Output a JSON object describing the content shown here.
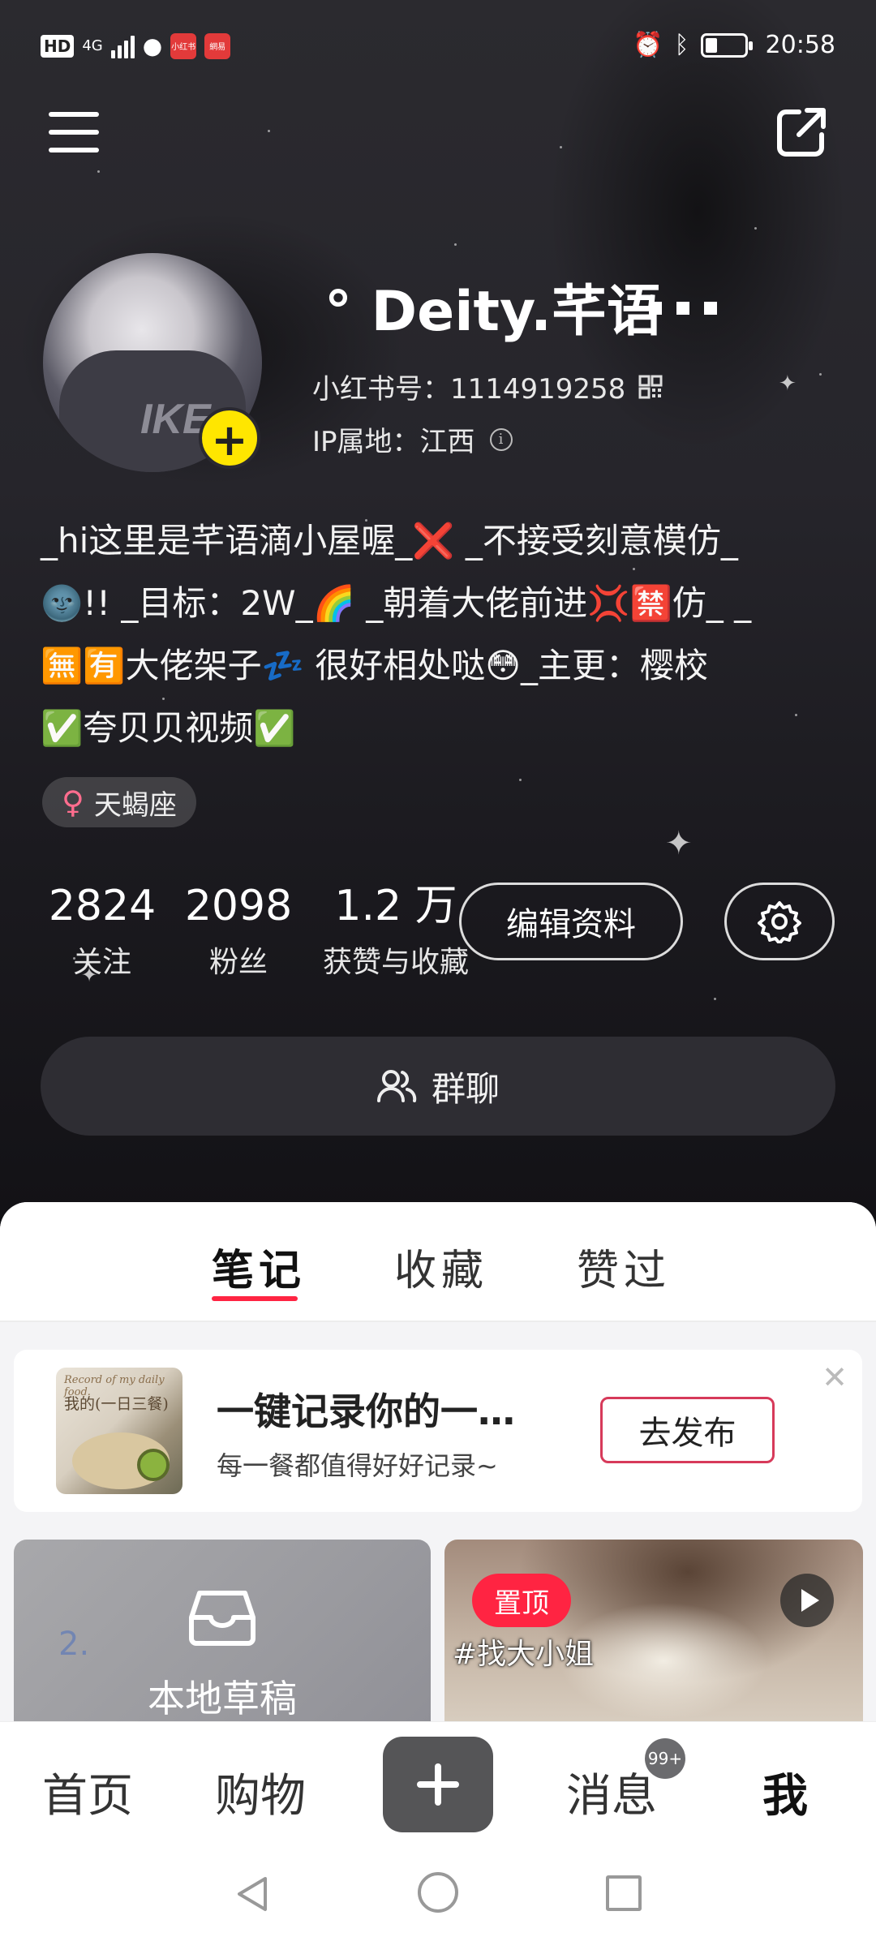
{
  "status_bar": {
    "hd": "HD",
    "network": "4G",
    "app1": "小红书",
    "app2": "網易",
    "time": "20:58"
  },
  "profile": {
    "nickname": "° Deity.芊语",
    "red_id": "小红书号：1114919258",
    "ip_location": "IP属地：江西",
    "bio": "_hi这里是芊语滴小屋喔_❌ _不接受刻意模仿_\n🌚!! _目标：2W_🌈 _朝着大佬前进💢🈲仿_ _\n🈚🈶大佬架子💤 很好相处哒😳_主更：樱校\n✅夸贝贝视频✅",
    "zodiac": "天蝎座",
    "stats": [
      {
        "value": "2824",
        "label": "关注"
      },
      {
        "value": "2098",
        "label": "粉丝"
      },
      {
        "value": "1.2 万",
        "label": "获赞与收藏"
      }
    ],
    "edit_button": "编辑资料",
    "group_chat": "群聊"
  },
  "tabs": [
    "笔记",
    "收藏",
    "赞过"
  ],
  "active_tab": "笔记",
  "promo": {
    "thumb_line1": "Record of my daily food.",
    "thumb_line2": "我的(一日三餐)",
    "title": "一键记录你的一…",
    "subtitle": "每一餐都值得好好记录~",
    "button": "去发布"
  },
  "cards": {
    "draft_label": "本地草稿",
    "draft_bg_number": "2.",
    "pinned_badge": "置顶",
    "video_tag": "#找大小姐"
  },
  "bottom_nav": {
    "home": "首页",
    "shop": "购物",
    "messages": "消息",
    "messages_badge": "99+",
    "me": "我"
  },
  "icons": {
    "menu": "menu-icon",
    "share": "share-icon",
    "qr": "qr-code-icon",
    "info": "info-icon",
    "settings": "gear-icon",
    "group": "people-icon",
    "close": "close-icon",
    "draft": "inbox-icon",
    "play": "play-icon",
    "add": "plus-icon"
  },
  "colors": {
    "accent": "#ff2442",
    "avatar_add": "#ffe600",
    "publish_border": "#d73a5a"
  }
}
